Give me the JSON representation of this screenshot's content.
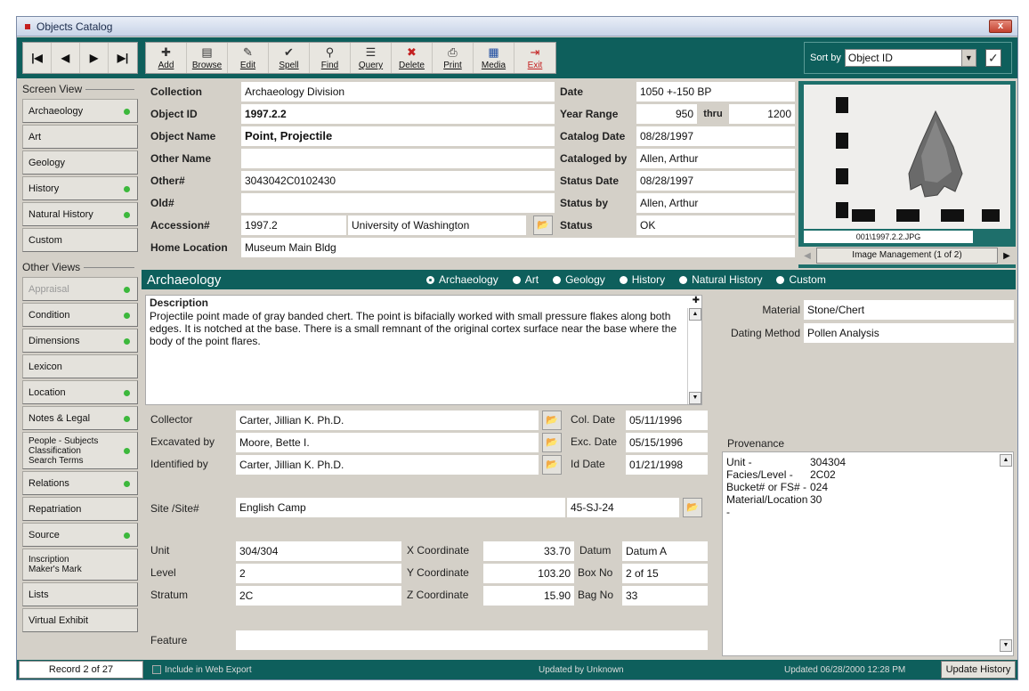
{
  "window": {
    "title": "Objects Catalog",
    "close_label": "x"
  },
  "toolbar": {
    "nav": [
      "|◀",
      "◀",
      "▶",
      "▶|"
    ],
    "buttons": [
      {
        "label": "Add",
        "icon": "✚"
      },
      {
        "label": "Browse",
        "icon": "▤"
      },
      {
        "label": "Edit",
        "icon": "✎"
      },
      {
        "label": "Spell",
        "icon": "✔"
      },
      {
        "label": "Find",
        "icon": "⚲"
      },
      {
        "label": "Query",
        "icon": "☰"
      },
      {
        "label": "Delete",
        "icon": "✖"
      },
      {
        "label": "Print",
        "icon": "⎙"
      },
      {
        "label": "Media",
        "icon": "▦"
      },
      {
        "label": "Exit",
        "icon": "⇥"
      }
    ],
    "sort_label": "Sort by",
    "sort_value": "Object ID",
    "sort_arrow": "▼",
    "check_icon": "✓"
  },
  "sidebar": {
    "screen_view_heading": "Screen View",
    "screen_views": [
      {
        "label": "Archaeology",
        "dot": true
      },
      {
        "label": "Art",
        "dot": false
      },
      {
        "label": "Geology",
        "dot": false
      },
      {
        "label": "History",
        "dot": true
      },
      {
        "label": "Natural History",
        "dot": true
      },
      {
        "label": "Custom",
        "dot": false
      }
    ],
    "other_views_heading": "Other Views",
    "other_views": [
      {
        "label": "Appraisal",
        "dot": true,
        "dim": true
      },
      {
        "label": "Condition",
        "dot": true
      },
      {
        "label": "Dimensions",
        "dot": true
      },
      {
        "label": "Lexicon",
        "dot": false
      },
      {
        "label": "Location",
        "dot": true
      },
      {
        "label": "Notes & Legal",
        "dot": true
      },
      {
        "label": "People - Subjects\nClassification\nSearch Terms",
        "dot": true,
        "multi": true
      },
      {
        "label": "Relations",
        "dot": true
      },
      {
        "label": "Repatriation",
        "dot": false
      },
      {
        "label": "Source",
        "dot": true
      },
      {
        "label": "Inscription\nMaker's Mark",
        "dot": false,
        "multi2": true
      },
      {
        "label": "Lists",
        "dot": false
      },
      {
        "label": "Virtual Exhibit",
        "dot": false
      }
    ]
  },
  "header": {
    "collection_label": "Collection",
    "collection": "Archaeology Division",
    "objectid_label": "Object ID",
    "objectid": "1997.2.2",
    "objectname_label": "Object Name",
    "objectname": "Point, Projectile",
    "othername_label": "Other Name",
    "othername": "",
    "othernum_label": "Other#",
    "othernum": "3043042C0102430",
    "oldnum_label": "Old#",
    "oldnum": "",
    "accession_label": "Accession#",
    "accession": "1997.2",
    "accession_source": "University of Washington",
    "homeloc_label": "Home Location",
    "homeloc": "Museum Main Bldg",
    "date_label": "Date",
    "date": "1050 +-150 BP",
    "yearrange_label": "Year Range",
    "year_from": "950",
    "thru_label": "thru",
    "year_to": "1200",
    "catdate_label": "Catalog Date",
    "catdate": "08/28/1997",
    "catby_label": "Cataloged by",
    "catby": "Allen, Arthur",
    "statusdate_label": "Status Date",
    "statusdate": "08/28/1997",
    "statusby_label": "Status by",
    "statusby": "Allen, Arthur",
    "status_label": "Status",
    "status": "OK"
  },
  "image": {
    "caption": "001\\1997.2.2.JPG",
    "mgmt_label": "Image Management (1 of 2)",
    "prev": "◀",
    "next": "▶"
  },
  "section": {
    "title": "Archaeology",
    "radios": [
      "Archaeology",
      "Art",
      "Geology",
      "History",
      "Natural History",
      "Custom"
    ],
    "selected": "Archaeology"
  },
  "archaeology": {
    "description_label": "Description",
    "description": "Projectile point made of gray banded chert.  The point is bifacially worked with small pressure flakes along both edges. It is notched at the base. There is a small remnant of the original cortex surface near the base where the body of the point flares.",
    "material_label": "Material",
    "material": "Stone/Chert",
    "dating_label": "Dating Method",
    "dating": "Pollen Analysis",
    "collector_label": "Collector",
    "collector": "Carter, Jillian K. Ph.D.",
    "excavated_label": "Excavated by",
    "excavated": "Moore, Bette I.",
    "identified_label": "Identified by",
    "identified": "Carter, Jillian K. Ph.D.",
    "coldate_label": "Col. Date",
    "coldate": "05/11/1996",
    "excdate_label": "Exc. Date",
    "excdate": "05/15/1996",
    "iddate_label": "Id Date",
    "iddate": "01/21/1998",
    "site_label": "Site /Site#",
    "site": "English Camp",
    "sitenum": "45-SJ-24",
    "unit_label": "Unit",
    "unit": "304/304",
    "level_label": "Level",
    "level": "2",
    "stratum_label": "Stratum",
    "stratum": "2C",
    "xcoord_label": "X Coordinate",
    "xcoord": "33.70",
    "ycoord_label": "Y Coordinate",
    "ycoord": "103.20",
    "zcoord_label": "Z Coordinate",
    "zcoord": "15.90",
    "datum_label": "Datum",
    "datum": "Datum A",
    "boxno_label": "Box No",
    "boxno": "2 of 15",
    "bagno_label": "Bag No",
    "bagno": "33",
    "feature_label": "Feature",
    "feature": "",
    "provenance_label": "Provenance",
    "provenance": [
      {
        "k": "Unit -",
        "v": "304304"
      },
      {
        "k": "Facies/Level -",
        "v": "2C02"
      },
      {
        "k": "Bucket# or FS# -",
        "v": "024"
      },
      {
        "k": "Material/Location -",
        "v": "30"
      }
    ]
  },
  "statusbar": {
    "record": "Record 2 of 27",
    "web_export": "Include in Web Export",
    "updated_by": "Updated by  Unknown",
    "updated": "Updated    06/28/2000 12:28 PM",
    "update_history": "Update History"
  },
  "colors": {
    "accent": "#0e5f5c",
    "dot_green": "#3cb83c"
  }
}
